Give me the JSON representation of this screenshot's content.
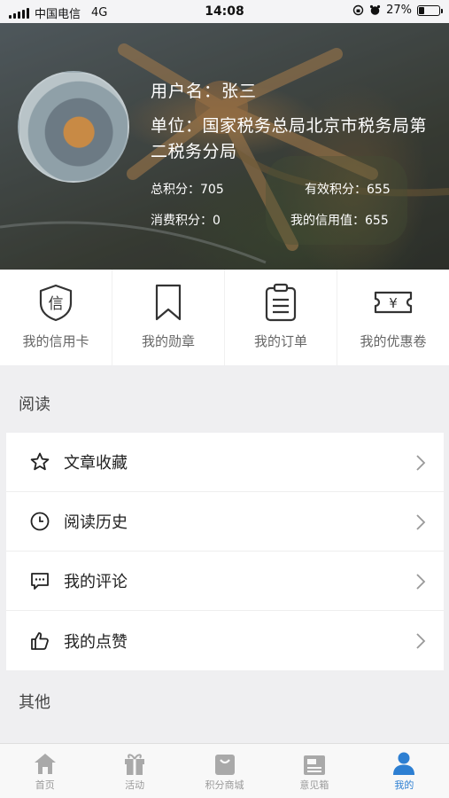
{
  "status_bar": {
    "carrier": "中国电信",
    "network": "4G",
    "time": "14:08",
    "battery": "27%",
    "battery_level": 0.27
  },
  "profile": {
    "name_line": "用户名：张三",
    "unit_line": "单位：国家税务总局北京市税务局第二税务分局",
    "total_points": "总积分：705",
    "valid_points": "有效积分：655",
    "spent_points": "消费积分：0",
    "credit_value": "我的信用值：655"
  },
  "quick_entries": [
    {
      "label": "我的信用卡",
      "icon": "shield-credit-icon"
    },
    {
      "label": "我的勋章",
      "icon": "bookmark-icon"
    },
    {
      "label": "我的订单",
      "icon": "clipboard-icon"
    },
    {
      "label": "我的优惠卷",
      "icon": "yuan-ticket-icon"
    }
  ],
  "sections": {
    "reading_title": "阅读",
    "other_title": "其他"
  },
  "reading_items": [
    {
      "label": "文章收藏",
      "icon": "star-icon"
    },
    {
      "label": "阅读历史",
      "icon": "clock-icon"
    },
    {
      "label": "我的评论",
      "icon": "comment-icon"
    },
    {
      "label": "我的点赞",
      "icon": "thumbs-up-icon"
    }
  ],
  "tabs": [
    {
      "label": "首页",
      "icon": "home-icon",
      "active": false
    },
    {
      "label": "活动",
      "icon": "gift-icon",
      "active": false
    },
    {
      "label": "积分商城",
      "icon": "shopping-bag-icon",
      "active": false
    },
    {
      "label": "意见箱",
      "icon": "mailbox-icon",
      "active": false
    },
    {
      "label": "我的",
      "icon": "user-icon",
      "active": true
    }
  ],
  "colors": {
    "accent": "#2d7fd2",
    "inactive_tab": "#9a9a9a",
    "background": "#efeff1"
  }
}
